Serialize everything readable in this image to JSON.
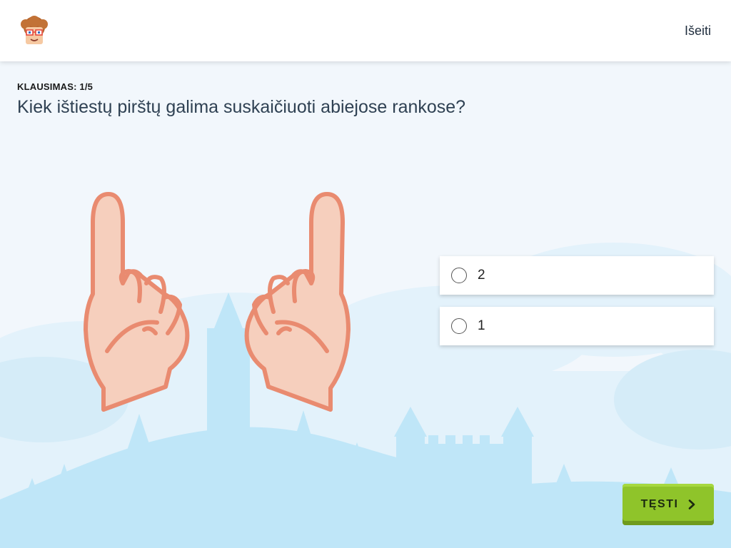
{
  "header": {
    "logo_icon": "kid-avatar-logo",
    "exit_label": "Išeiti"
  },
  "question": {
    "counter": "KLAUSIMAS: 1/5",
    "text": "Kiek ištiestų pirštų galima suskaičiuoti abiejose rankose?",
    "illustration": "two-hands-index-finger-up"
  },
  "options": [
    {
      "label": "2",
      "selected": false
    },
    {
      "label": "1",
      "selected": false
    }
  ],
  "continue_button": {
    "label": "TĘSTI",
    "icon": "chevron-right-icon"
  },
  "colors": {
    "accent_green": "#8fc42a",
    "background": "#f2f7fc",
    "scenery": "#bfe6f8",
    "hand_fill": "#f6cfbd",
    "hand_outline": "#e98b70"
  }
}
